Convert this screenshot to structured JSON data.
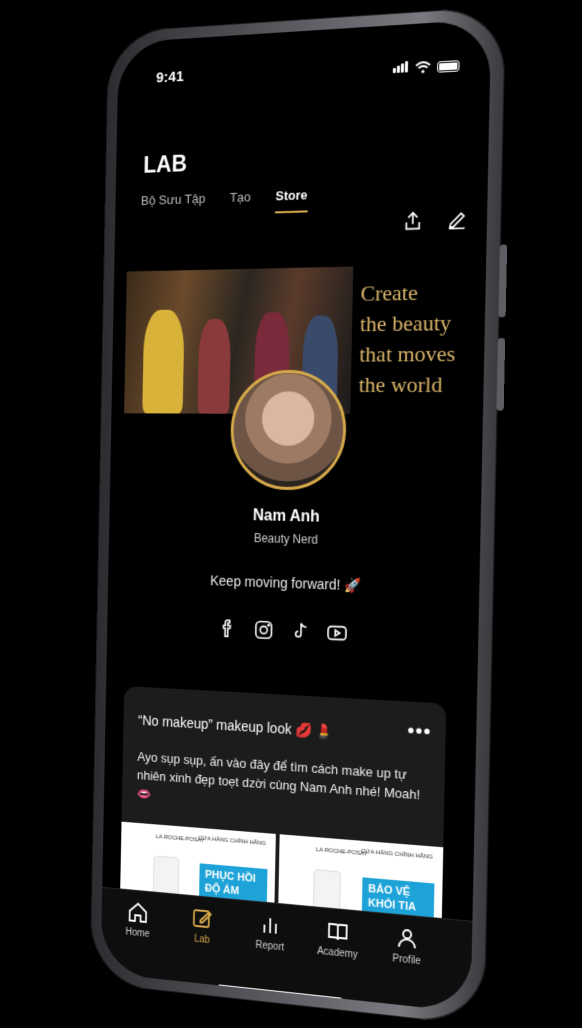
{
  "status": {
    "time": "9:41"
  },
  "header": {
    "title": "LAB",
    "tabs": [
      {
        "label": "Bộ Sưu Tập",
        "active": false
      },
      {
        "label": "Tạo",
        "active": false
      },
      {
        "label": "Store",
        "active": true
      }
    ]
  },
  "banner": {
    "slogan_lines": [
      "Create",
      "the beauty",
      "that moves",
      "the world"
    ]
  },
  "profile": {
    "name": "Nam Anh",
    "role": "Beauty Nerd",
    "motto": "Keep moving forward! 🚀"
  },
  "socials": [
    "facebook-icon",
    "instagram-icon",
    "tiktok-icon",
    "youtube-icon"
  ],
  "post": {
    "title": "“No makeup” makeup look 💋 💄",
    "more": "•••",
    "description": "Ayo sụp sụp, ấn vào đây để tìm cách make up tự nhiên xinh đẹp toẹt dzời cùng Nam Anh nhé! Moah! 👄",
    "products": [
      {
        "brand": "LA ROCHE-POSAY",
        "store": "CỬA HÀNG CHÍNH HÃNG",
        "tag": "PHỤC HỒI ĐỘ ẨM"
      },
      {
        "brand": "LA ROCHE-POSAY",
        "store": "CỬA HÀNG CHÍNH HÃNG",
        "tag": "BẢO VỆ KHỎI TIA UVA"
      }
    ]
  },
  "bottom_nav": [
    {
      "label": "Home",
      "icon": "home-icon",
      "active": false
    },
    {
      "label": "Lab",
      "icon": "edit-icon",
      "active": true
    },
    {
      "label": "Report",
      "icon": "bar-chart-icon",
      "active": false
    },
    {
      "label": "Academy",
      "icon": "book-icon",
      "active": false
    },
    {
      "label": "Profile",
      "icon": "user-icon",
      "active": false
    }
  ],
  "colors": {
    "accent": "#d6a94a",
    "background": "#000000",
    "card": "#1c1c1c"
  }
}
